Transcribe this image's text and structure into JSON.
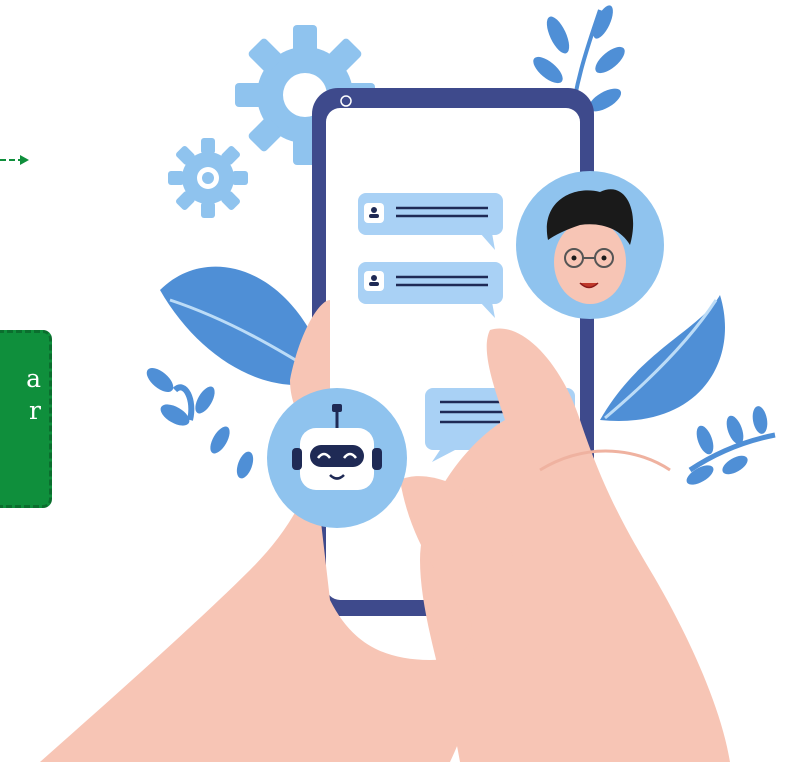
{
  "green_box": {
    "line1": "a",
    "line2": "r"
  },
  "icons": {
    "gear_large": "gear-icon",
    "gear_small": "gear-icon",
    "user_avatar": "user-avatar-icon",
    "bot_avatar": "robot-icon",
    "user_small": "person-icon",
    "bot_small": "robot-icon",
    "leaves": "leaf-icon"
  },
  "colors": {
    "accent_green": "#0f8f3c",
    "phone_frame": "#3e4a8c",
    "bubble_blue": "#a9d1f5",
    "light_blue": "#8fc3ee",
    "leaf_blue": "#4f8fd6",
    "skin": "#f7c5b5"
  }
}
